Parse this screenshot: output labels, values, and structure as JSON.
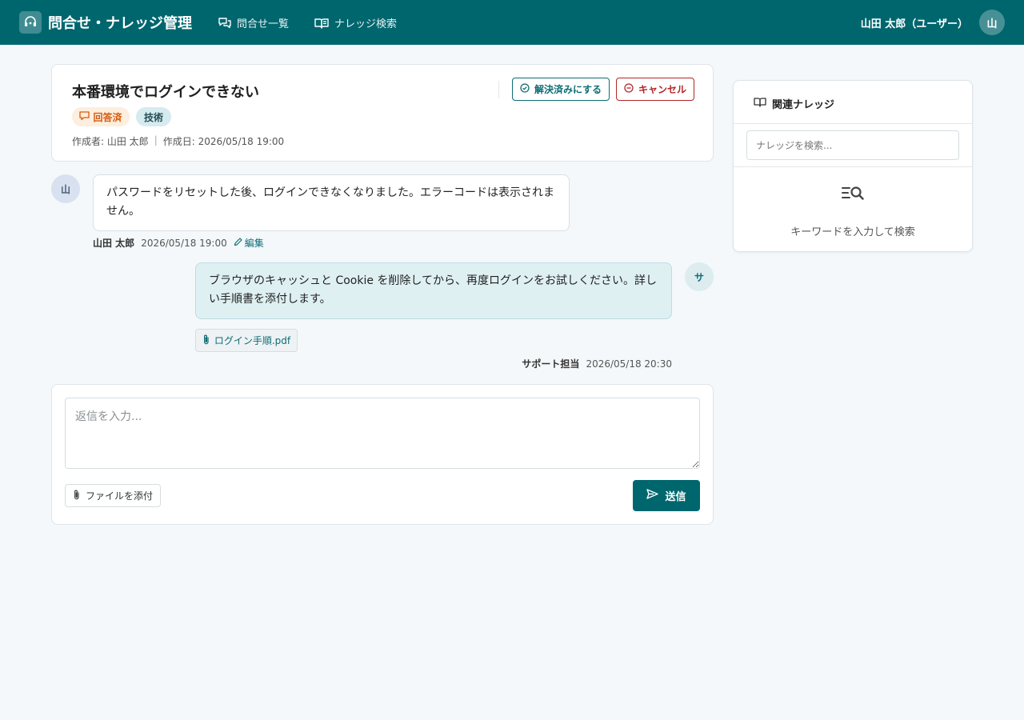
{
  "header": {
    "app_title": "問合せ・ナレッジ管理",
    "nav": [
      {
        "label": "問合せ一覧",
        "icon": "chat-list-icon"
      },
      {
        "label": "ナレッジ検索",
        "icon": "book-icon"
      }
    ],
    "user_name": "山田 太郎（ユーザー）",
    "user_avatar": "山"
  },
  "ticket": {
    "title": "本番環境でログインできない",
    "resolve_label": "解決済みにする",
    "cancel_label": "キャンセル",
    "status_label": "回答済",
    "category_label": "技術",
    "author": "作成者: 山田 太郎",
    "created": "作成日: 2026/05/18 19:00"
  },
  "messages": [
    {
      "avatar": "山",
      "text": "パスワードをリセットした後、ログインできなくなりました。エラーコードは表示されません。",
      "author": "山田 太郎",
      "time": "2026/05/18 19:00",
      "edit_label": "編集"
    },
    {
      "avatar": "サ",
      "text": "ブラウザのキャッシュと Cookie を削除してから、再度ログインをお試しください。詳しい手順書を添付します。",
      "attachment": "ログイン手順.pdf",
      "author": "サポート担当",
      "time": "2026/05/18 20:30"
    }
  ],
  "reply": {
    "placeholder": "返信を入力...",
    "attach_label": "ファイルを添付",
    "send_label": "送信"
  },
  "knowledge": {
    "title": "関連ナレッジ",
    "search_placeholder": "ナレッジを検索...",
    "empty_text": "キーワードを入力して検索"
  },
  "colors": {
    "primary": "#00666e",
    "status_bg": "#fdeedd",
    "status_text": "#d55a10",
    "danger": "#b32626"
  }
}
